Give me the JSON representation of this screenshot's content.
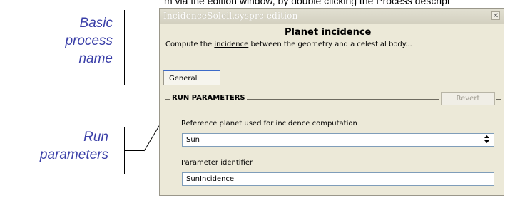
{
  "caption": "m via the edition window, by double clicking the Process descript",
  "annotations": {
    "basic_process_name": [
      "Basic",
      "process",
      "name"
    ],
    "run_parameters": [
      "Run",
      "parameters"
    ]
  },
  "window": {
    "title": "IncidenceSoleil.sysprc edition",
    "close_glyph": "✕",
    "process_title": "Planet incidence",
    "description_prefix": "Compute the ",
    "description_link": "incidence",
    "description_suffix": " between the geometry and a celestial body...",
    "tabs": [
      {
        "label": "General"
      }
    ],
    "group": {
      "label": "RUN PARAMETERS",
      "revert_label": "Revert"
    },
    "fields": {
      "planet_label": "Reference planet used for incidence computation",
      "planet_value": "Sun",
      "identifier_label": "Parameter identifier",
      "identifier_value": "SunIncidence"
    }
  },
  "icons": {
    "select_arrow": "updown-arrow-icon",
    "close": "close-icon"
  }
}
